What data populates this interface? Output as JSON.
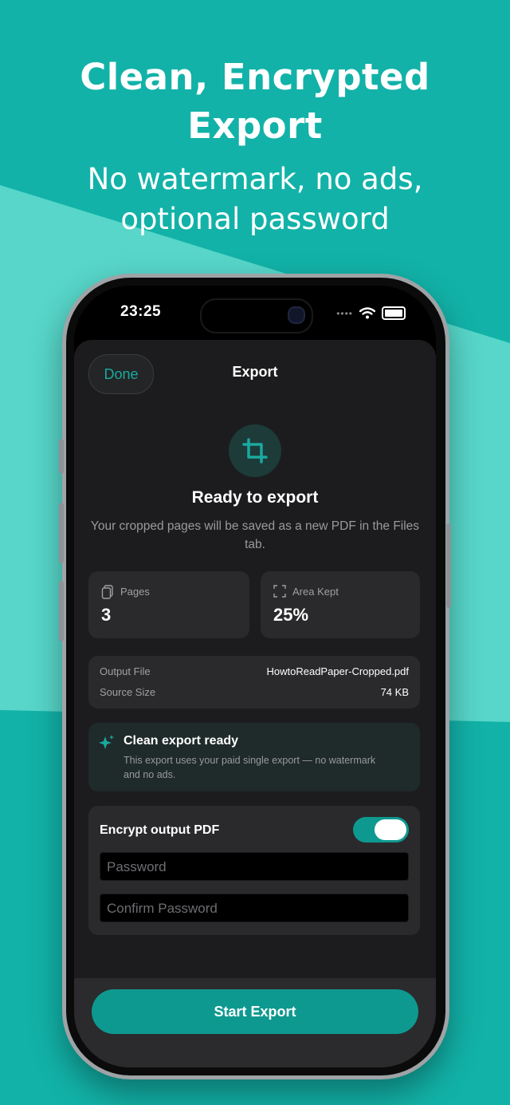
{
  "promo": {
    "headline_line1": "Clean, Encrypted",
    "headline_line2": "Export",
    "subhead_line1": "No watermark, no ads,",
    "subhead_line2": "optional password"
  },
  "status_bar": {
    "time": "23:25",
    "icons": [
      "signal-dots-icon",
      "wifi-icon",
      "battery-icon"
    ]
  },
  "nav": {
    "done_label": "Done",
    "title": "Export"
  },
  "hero": {
    "icon": "crop-icon",
    "title": "Ready to export",
    "subtitle": "Your cropped pages will be saved as a new PDF in the Files tab."
  },
  "stats": [
    {
      "icon": "pages-icon",
      "label": "Pages",
      "value": "3"
    },
    {
      "icon": "area-icon",
      "label": "Area Kept",
      "value": "25%"
    }
  ],
  "output": {
    "file_label": "Output File",
    "file_value": "HowtoReadPaper-Cropped.pdf",
    "size_label": "Source Size",
    "size_value": "74 KB"
  },
  "clean_export": {
    "icon": "sparkle-icon",
    "title": "Clean export ready",
    "subtitle": "This export uses your paid single export — no watermark and no ads."
  },
  "encrypt": {
    "label": "Encrypt output PDF",
    "enabled": true,
    "password_placeholder": "Password",
    "confirm_placeholder": "Confirm Password"
  },
  "footer": {
    "start_label": "Start Export"
  },
  "colors": {
    "background": "#12b2a8",
    "accent": "#0e9990",
    "sheet": "#1c1c1e",
    "card": "#2a2a2c"
  }
}
